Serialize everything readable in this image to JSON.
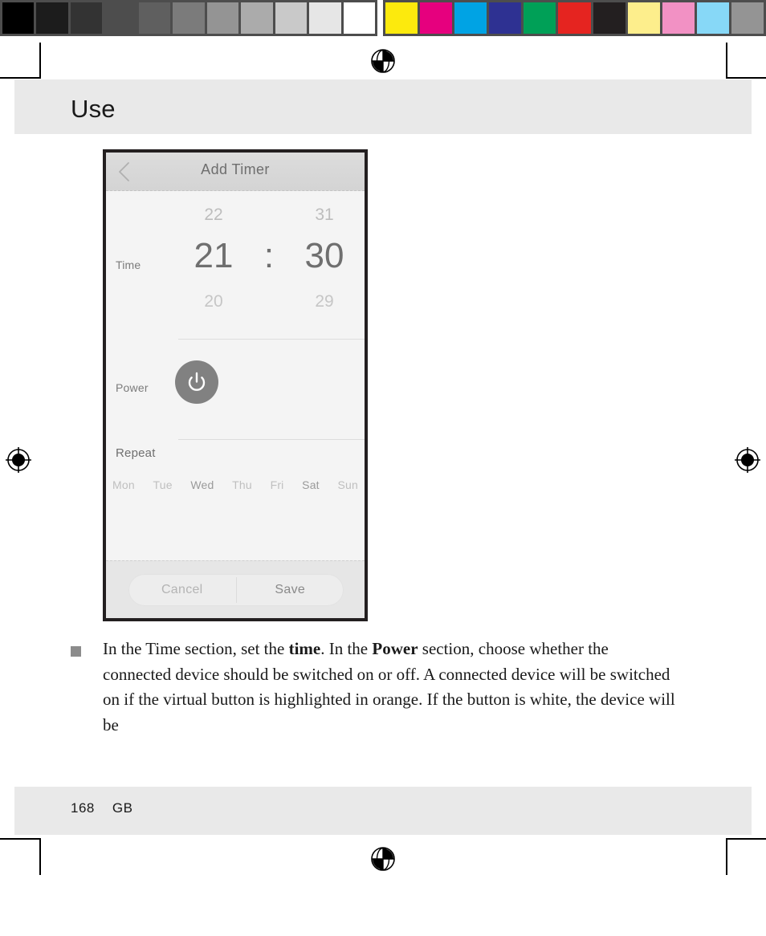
{
  "calibration": {
    "grayscale": [
      "#000000",
      "#1c1c1c",
      "#333333",
      "#4d4d4d",
      "#5f5f5f",
      "#7b7b7b",
      "#949494",
      "#ababab",
      "#c9c9c9",
      "#e6e6e6",
      "#ffffff"
    ],
    "colors": [
      "#fcea0d",
      "#e6007e",
      "#00a3e4",
      "#2e3192",
      "#00a057",
      "#e52420",
      "#231f20",
      "#fdee8c",
      "#f291c4",
      "#87d8f7",
      "#949494"
    ]
  },
  "header": {
    "title": "Use"
  },
  "footer": {
    "page_number": "168",
    "language_code": "GB"
  },
  "phone_screenshot": {
    "nav": {
      "back_icon": "chevron-left-icon",
      "title": "Add Timer"
    },
    "time_section": {
      "label": "Time",
      "hours": {
        "previous": "22",
        "selected": "21",
        "next": "20"
      },
      "separator": ":",
      "minutes": {
        "previous": "31",
        "selected": "30",
        "next": "29"
      }
    },
    "power_section": {
      "label": "Power",
      "button_icon": "power-icon",
      "button_color": "#818181",
      "button_state": "off"
    },
    "repeat_section": {
      "label": "Repeat",
      "days": [
        "Mon",
        "Tue",
        "Wed",
        "Thu",
        "Fri",
        "Sat",
        "Sun"
      ]
    },
    "actions": {
      "cancel_label": "Cancel",
      "save_label": "Save"
    }
  },
  "instruction": {
    "bullet_marker": "square-bullet",
    "segments": [
      {
        "text": "In the Time section, set the ",
        "bold": false
      },
      {
        "text": "time",
        "bold": true
      },
      {
        "text": ". In the ",
        "bold": false
      },
      {
        "text": "Power",
        "bold": true
      },
      {
        "text": " section, choose whether the connected device should be switched on or off. A connected device will be switched on if the virtual button is highlighted in orange. If the button is white, the device will be",
        "bold": false
      }
    ],
    "full_text": "In the Time section, set the time. In the Power section, choose whether the connected device should be switched on or off. A connected device will be switched on if the virtual button is highlighted in orange. If the button is white, the device will be"
  }
}
